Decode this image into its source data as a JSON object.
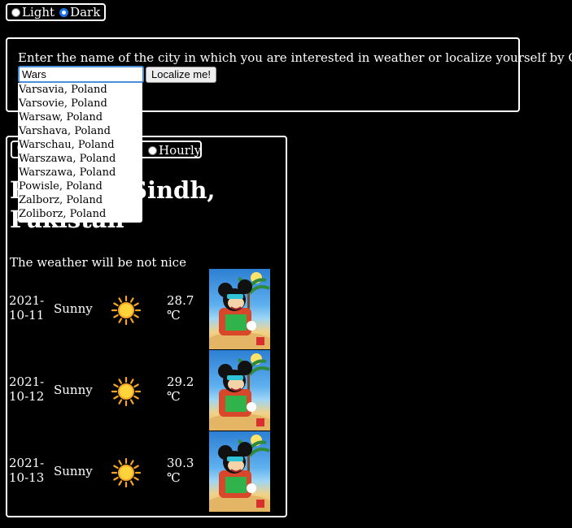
{
  "theme": {
    "options": [
      {
        "label": "Light",
        "checked": false
      },
      {
        "label": "Dark",
        "checked": true
      }
    ]
  },
  "search": {
    "prompt": "Enter the name of the city in which you are interested in weather or localize yourself by GPS!",
    "value": "Wars",
    "button_label": "Localize me!",
    "suggestions": [
      "Varsavia, Poland",
      "Varsovie, Poland",
      "Warsaw, Poland",
      "Varshava, Poland",
      "Warschau, Poland",
      "Warszawa, Poland",
      "Warszawa, Poland",
      "Powisle, Poland",
      "Zalborz, Poland",
      "Zoliborz, Poland"
    ]
  },
  "weather": {
    "mode_options": [
      {
        "label": "",
        "checked": false
      },
      {
        "label": "Hourly",
        "checked": false
      }
    ],
    "location_title": "Karachi, Sindh, Pakistan",
    "summary": "The weather will be not nice",
    "forecast": [
      {
        "date": "2021-10-11",
        "description": "Sunny",
        "icon": "sun-icon",
        "temperature": "28.7 ℃"
      },
      {
        "date": "2021-10-12",
        "description": "Sunny",
        "icon": "sun-icon",
        "temperature": "29.2 ℃"
      },
      {
        "date": "2021-10-13",
        "description": "Sunny",
        "icon": "sun-icon",
        "temperature": "30.3 ℃"
      }
    ]
  },
  "colors": {
    "background": "#000000",
    "text": "#ffffff",
    "sun": "#f5a623",
    "accent": "#1a73e8"
  }
}
